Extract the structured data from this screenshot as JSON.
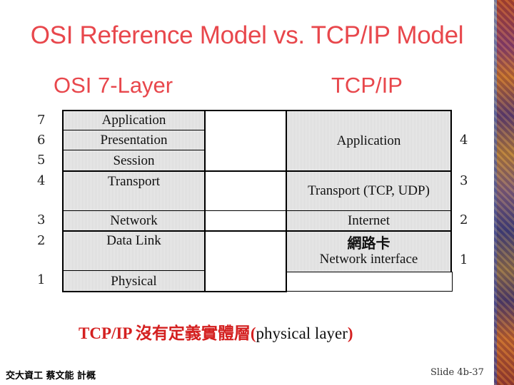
{
  "slide": {
    "title": "OSI Reference Model vs. TCP/IP Model",
    "osi_heading": "OSI 7-Layer",
    "tcp_heading": "TCP/IP",
    "osi_layers": [
      {
        "number": "7",
        "name": "Application"
      },
      {
        "number": "6",
        "name": "Presentation"
      },
      {
        "number": "5",
        "name": "Session"
      },
      {
        "number": "4",
        "name": "Transport"
      },
      {
        "number": "3",
        "name": "Network"
      },
      {
        "number": "2",
        "name": "Data Link"
      },
      {
        "number": "1",
        "name": "Physical"
      }
    ],
    "tcp_layers": [
      {
        "number": "4",
        "name": "Application"
      },
      {
        "number": "3",
        "name": "Transport (TCP, UDP)"
      },
      {
        "number": "2",
        "name": "Internet"
      },
      {
        "number": "1",
        "name_cjk": "網路卡",
        "name": "Network interface"
      }
    ],
    "note": {
      "red_prefix": "TCP/IP 沒有定義實體層(",
      "black_middle": "physical layer",
      "red_suffix": ")"
    },
    "footer": {
      "left": "交大資工 蔡文能 計概",
      "right": "Slide 4b-37"
    }
  }
}
